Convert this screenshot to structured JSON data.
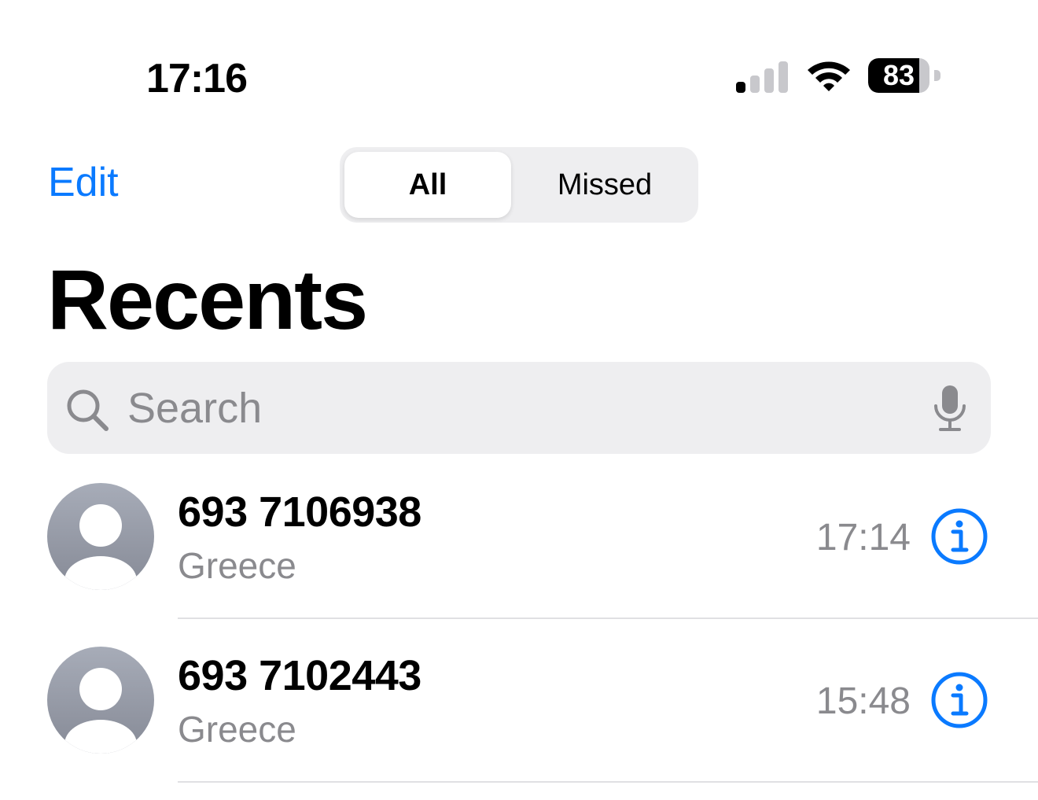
{
  "status_bar": {
    "time": "17:16",
    "battery_level": "83",
    "battery_fraction": 0.83,
    "signal_bars_active": 1,
    "signal_bars_total": 4
  },
  "nav": {
    "edit_label": "Edit",
    "segments": [
      {
        "label": "All",
        "selected": true
      },
      {
        "label": "Missed",
        "selected": false
      }
    ]
  },
  "page": {
    "title": "Recents"
  },
  "search": {
    "placeholder": "Search",
    "value": ""
  },
  "calls": [
    {
      "number": "693 7106938",
      "location": "Greece",
      "time": "17:14"
    },
    {
      "number": "693 7102443",
      "location": "Greece",
      "time": "15:48"
    }
  ],
  "colors": {
    "accent": "#0a7aff",
    "secondary_text": "#8a8a8e",
    "search_background": "#eeeef0",
    "avatar_top": "#a7acb8",
    "avatar_bottom": "#868a96"
  },
  "icons": {
    "search": "magnifying-glass-icon",
    "mic": "microphone-icon",
    "info": "info-circle-icon",
    "avatar": "person-placeholder-icon",
    "wifi": "wifi-icon",
    "signal": "cellular-signal-icon"
  }
}
